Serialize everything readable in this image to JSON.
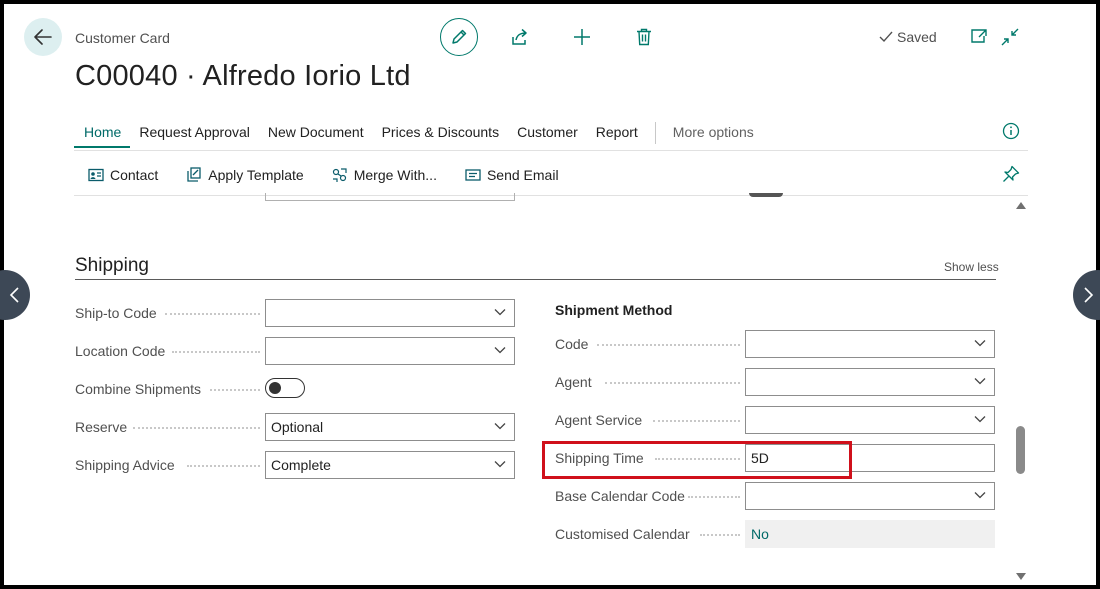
{
  "header": {
    "breadcrumb": "Customer Card",
    "title": "C00040 · Alfredo Iorio Ltd",
    "saved_status": "Saved"
  },
  "nav": {
    "items": [
      "Home",
      "Request Approval",
      "New Document",
      "Prices & Discounts",
      "Customer",
      "Report"
    ],
    "more": "More options"
  },
  "actions": [
    {
      "label": "Contact",
      "icon": "contact-card-icon"
    },
    {
      "label": "Apply Template",
      "icon": "apply-template-icon"
    },
    {
      "label": "Merge With...",
      "icon": "merge-icon"
    },
    {
      "label": "Send Email",
      "icon": "email-icon"
    }
  ],
  "section": {
    "title": "Shipping",
    "toggle_label": "Show less"
  },
  "left_fields": {
    "ship_to_code": {
      "label": "Ship-to Code",
      "value": ""
    },
    "location_code": {
      "label": "Location Code",
      "value": ""
    },
    "combine_shipments": {
      "label": "Combine Shipments",
      "value": "off"
    },
    "reserve": {
      "label": "Reserve",
      "value": "Optional"
    },
    "shipping_advice": {
      "label": "Shipping Advice",
      "value": "Complete"
    }
  },
  "right_fields": {
    "heading": "Shipment Method",
    "code": {
      "label": "Code",
      "value": ""
    },
    "agent": {
      "label": "Agent",
      "value": ""
    },
    "agent_service": {
      "label": "Agent Service",
      "value": ""
    },
    "shipping_time": {
      "label": "Shipping Time",
      "value": "5D"
    },
    "base_calendar_code": {
      "label": "Base Calendar Code",
      "value": ""
    },
    "customised_calendar": {
      "label": "Customised Calendar",
      "value": "No"
    }
  },
  "colors": {
    "accent": "#00796b",
    "highlight": "#d0101b"
  }
}
